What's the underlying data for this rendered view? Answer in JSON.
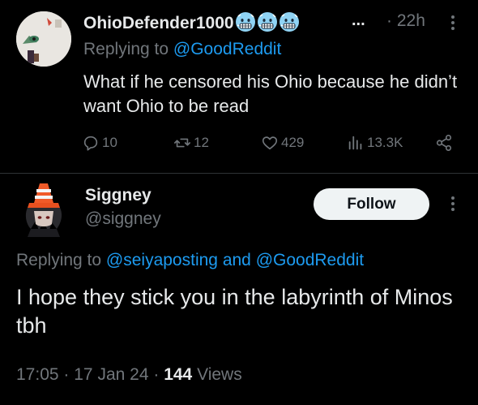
{
  "reply_tweet": {
    "display_name": "OhioDefender1000",
    "name_emojis": [
      "cold-face-emoji",
      "cold-face-emoji",
      "cold-face-emoji"
    ],
    "truncation": "...",
    "time_separator": "·",
    "time_ago": "22h",
    "replying_to_prefix": "Replying to",
    "replying_to_handle": "@GoodReddit",
    "text": "What if he censored his Ohio because he didn’t want Ohio to be read",
    "actions": {
      "replies": "10",
      "retweets": "12",
      "likes": "429",
      "views": "13.3K"
    },
    "icons": [
      "reply-icon",
      "retweet-icon",
      "like-icon",
      "views-icon",
      "share-icon",
      "more-icon"
    ]
  },
  "main_tweet": {
    "display_name": "Siggney",
    "handle": "@siggney",
    "follow_label": "Follow",
    "replying_to_prefix": "Replying to",
    "replying_to_handle_1": "@seiyaposting",
    "replying_to_and": "and",
    "replying_to_handle_2": "@GoodReddit",
    "text": "I hope they stick you in the labyrinth of Minos tbh",
    "time": "17:05",
    "date": "17 Jan 24",
    "separator": "·",
    "views_count": "144",
    "views_label": "Views"
  },
  "colors": {
    "background": "#000000",
    "text": "#e7e9ea",
    "muted": "#71767b",
    "link": "#1d9bf0",
    "follow_bg": "#eff3f4",
    "emoji_face": "#8fd3f4"
  }
}
